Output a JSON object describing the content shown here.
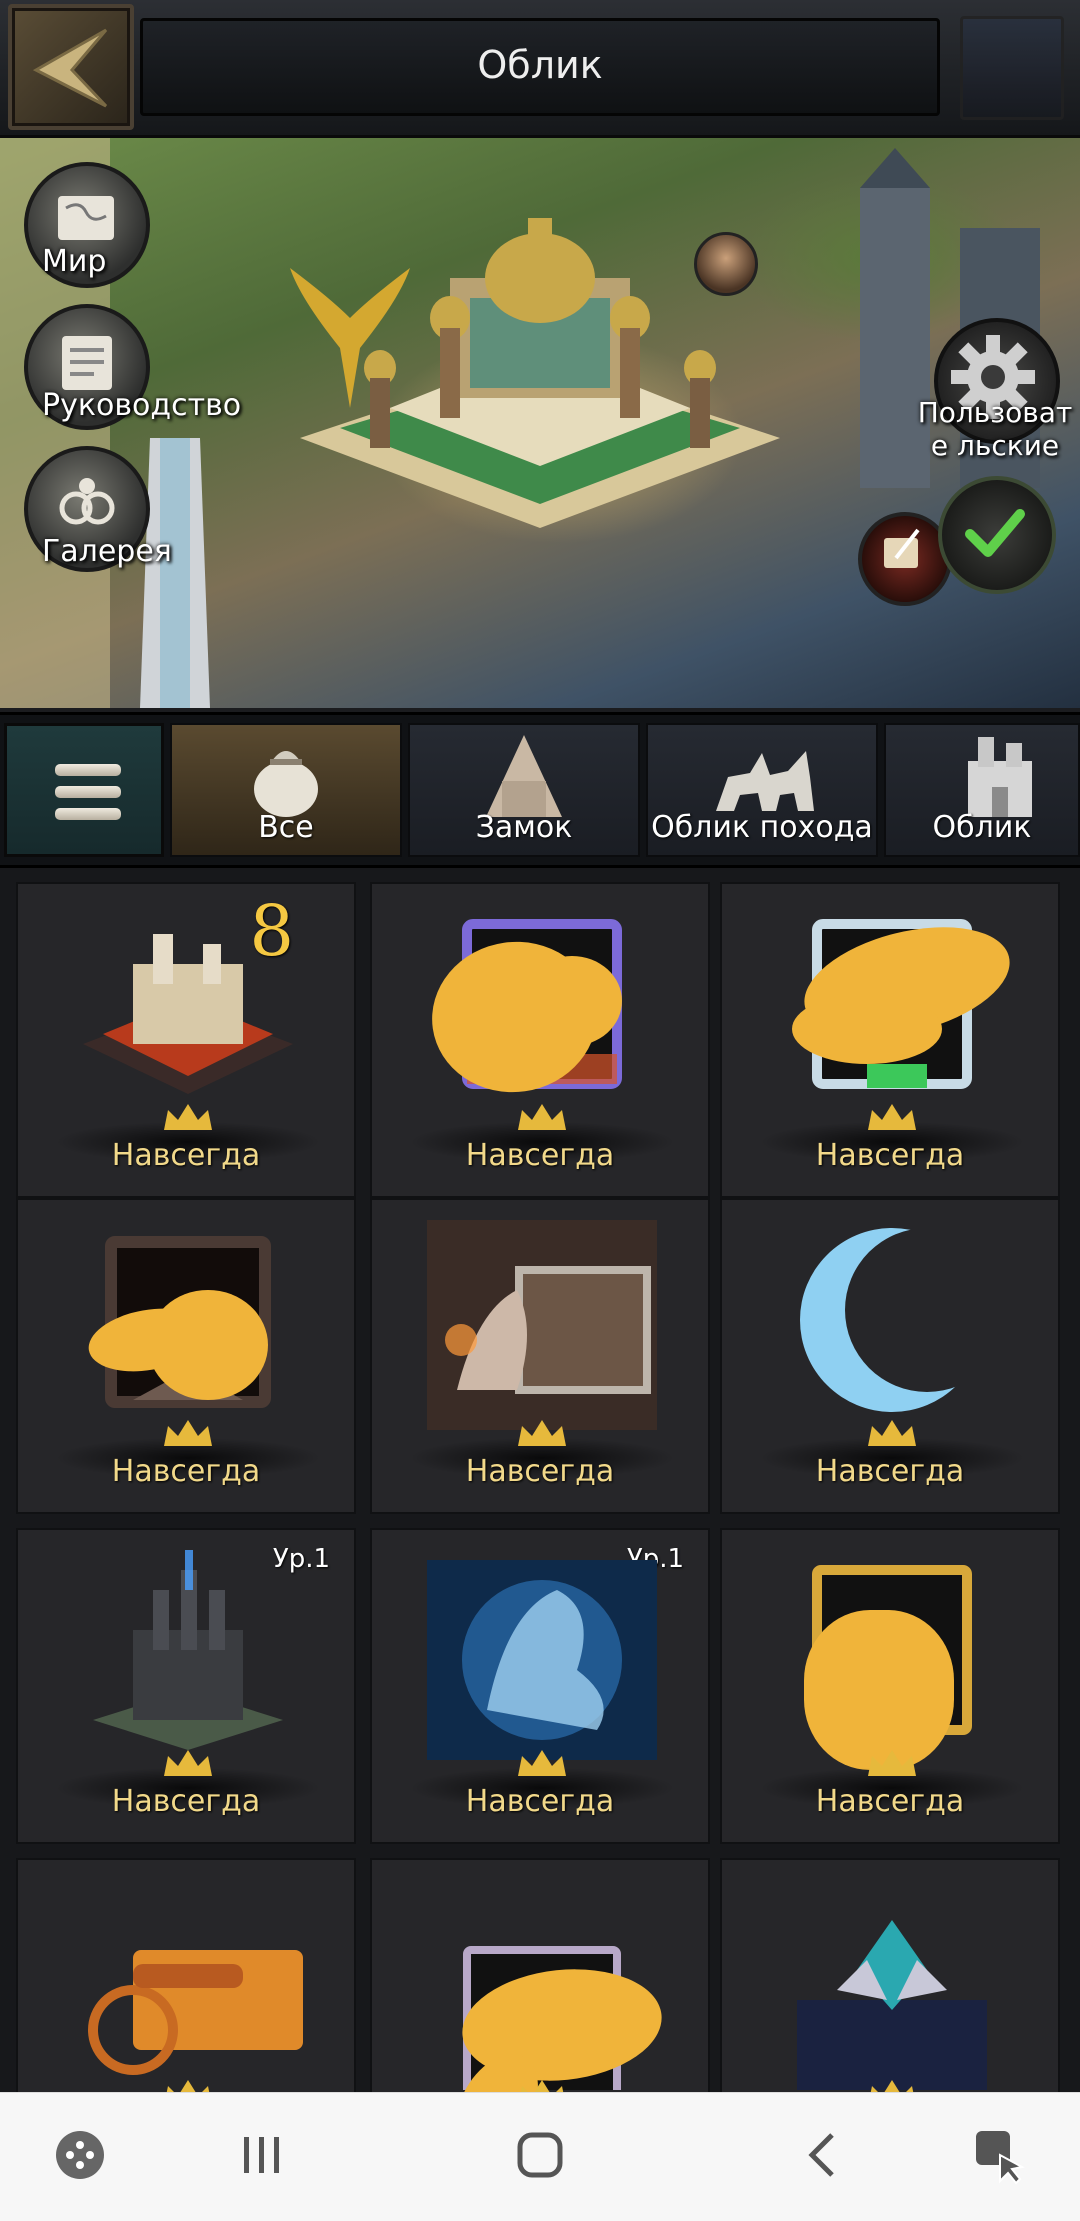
{
  "header": {
    "title": "Облик"
  },
  "scene": {
    "side_buttons": [
      {
        "label": "Мир",
        "icon": "map-scroll-icon"
      },
      {
        "label": "Руководство",
        "icon": "guide-scroll-icon"
      },
      {
        "label": "Галерея",
        "icon": "gallery-icon"
      }
    ],
    "custom_label": "Пользовате льские",
    "confirm_icon": "check-icon"
  },
  "tabs": [
    {
      "label": "Все",
      "icon": "bag-icon",
      "active": true
    },
    {
      "label": "Замок",
      "icon": "castle-icon",
      "active": false
    },
    {
      "label": "Облик похода",
      "icon": "march-icon",
      "active": false
    },
    {
      "label": "Облик",
      "icon": "building-icon",
      "active": false
    }
  ],
  "items": [
    {
      "label": "Навсегда",
      "level": "",
      "badge": "8",
      "kind": "castle-skin"
    },
    {
      "label": "Навсегда",
      "level": "",
      "kind": "avatar-frame"
    },
    {
      "label": "Навсегда",
      "level": "",
      "kind": "avatar-frame"
    },
    {
      "label": "Навсегда",
      "level": "",
      "kind": "avatar-frame"
    },
    {
      "label": "Навсегда",
      "level": "",
      "kind": "nameplate"
    },
    {
      "label": "Навсегда",
      "level": "",
      "kind": "crescent-moon"
    },
    {
      "label": "Навсегда",
      "level": "Ур.1",
      "kind": "dark-castle"
    },
    {
      "label": "Навсегда",
      "level": "Ур.1",
      "kind": "ice-dragon"
    },
    {
      "label": "Навсегда",
      "level": "",
      "kind": "avatar-frame"
    },
    {
      "label": "",
      "level": "",
      "kind": "cannon-nameplate"
    },
    {
      "label": "",
      "level": "",
      "kind": "avatar-frame"
    },
    {
      "label": "",
      "level": "",
      "kind": "crystal-banner"
    }
  ],
  "navbar": {
    "icons": [
      "game-launcher-icon",
      "recent-apps-icon",
      "home-icon",
      "back-icon",
      "assistant-icon"
    ]
  },
  "colors": {
    "gold_text": "#f2d98a",
    "redaction": "#f0b43a",
    "active_tab": "#5a4a30"
  }
}
